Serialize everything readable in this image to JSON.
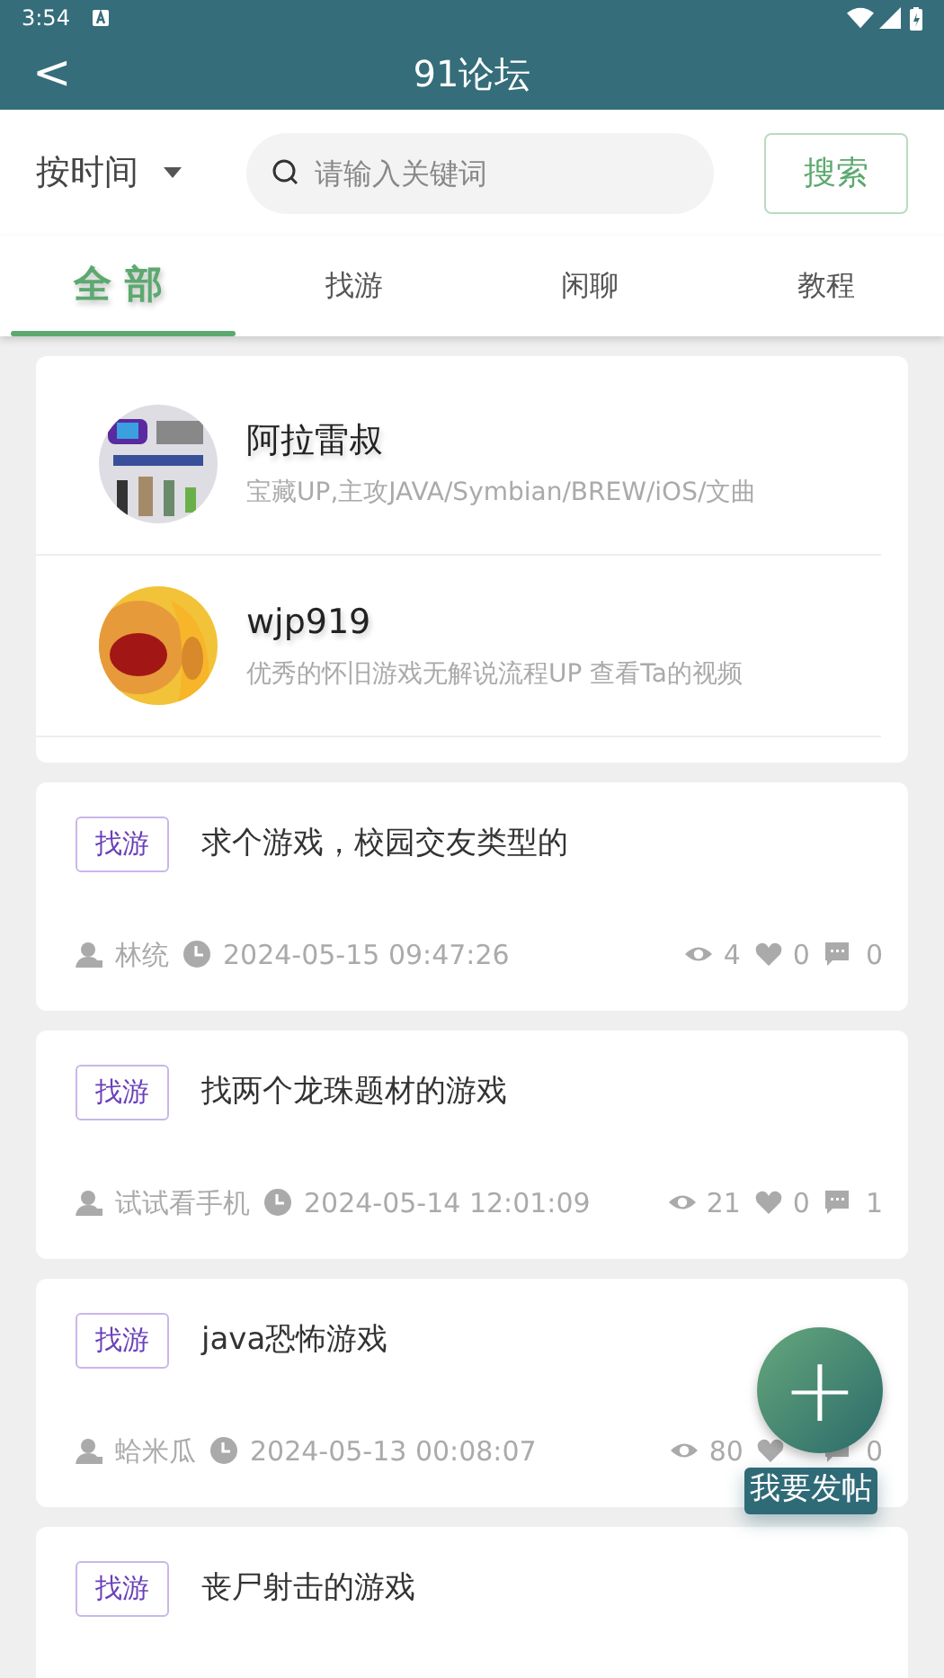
{
  "status_bar": {
    "time": "3:54"
  },
  "header": {
    "back": "<",
    "title": "91论坛"
  },
  "filter": {
    "sort": "按时间",
    "search_placeholder": "请输入关键词",
    "search_button": "搜索"
  },
  "tabs": [
    {
      "label": "全 部",
      "selected": true
    },
    {
      "label": "找游",
      "selected": false
    },
    {
      "label": "闲聊",
      "selected": false
    },
    {
      "label": "教程",
      "selected": false
    }
  ],
  "uploaders": [
    {
      "name": "阿拉雷叔",
      "description": "宝藏UP,主攻JAVA/Symbian/BREW/iOS/文曲"
    },
    {
      "name": "wjp919",
      "description": "优秀的怀旧游戏无解说流程UP   查看Ta的视频"
    }
  ],
  "posts": [
    {
      "tag": "找游",
      "title": "求个游戏，校园交友类型的",
      "author": "林统",
      "time": "2024-05-15 09:47:26",
      "views": "4",
      "likes": "0",
      "comments": "0"
    },
    {
      "tag": "找游",
      "title": "找两个龙珠题材的游戏",
      "author": "试试看手机",
      "time": "2024-05-14 12:01:09",
      "views": "21",
      "likes": "0",
      "comments": "1"
    },
    {
      "tag": "找游",
      "title": "java恐怖游戏",
      "author": "蛤米瓜",
      "time": "2024-05-13 00:08:07",
      "views": "80",
      "comments": "0"
    },
    {
      "tag": "找游",
      "title": "丧尸射击的游戏"
    }
  ],
  "fab": {
    "symbol": "+",
    "label": "我要发帖"
  }
}
